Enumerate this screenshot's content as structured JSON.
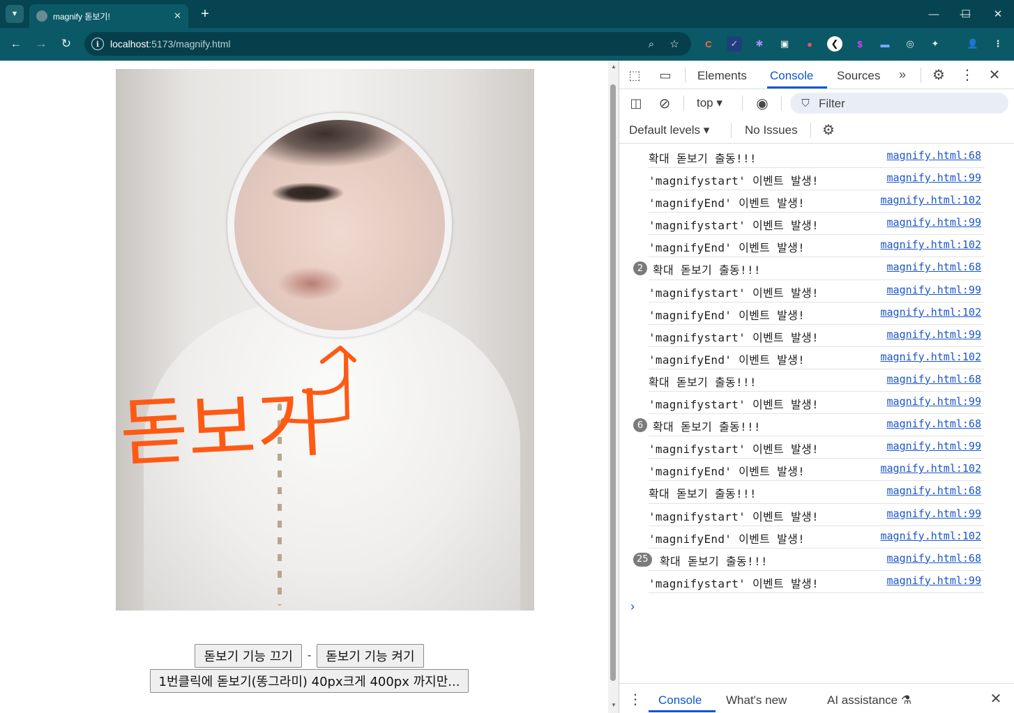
{
  "browser": {
    "tab_title": "magnify 돋보기!",
    "new_tab_symbol": "+",
    "url_host": "localhost",
    "url_rest": ":5173/magnify.html",
    "window_controls": [
      "—",
      "☐",
      "✕"
    ],
    "extension_icons": [
      "C",
      "✓",
      "✱",
      "▣",
      "●",
      "❮",
      "$",
      "▬",
      "◎",
      "✦",
      "👤",
      "⋮"
    ]
  },
  "page": {
    "annotation_text": "돋보기",
    "buttons": {
      "off": "돋보기 기능 끄기",
      "separator": "-",
      "on": "돋보기 기능 켜기",
      "circle": "1번클릭에 돋보기(똥그라미) 40px크게 400px 까지만..."
    }
  },
  "devtools": {
    "tabs": [
      "Elements",
      "Console",
      "Sources"
    ],
    "active_tab": "Console",
    "context": "top",
    "filter_placeholder": "Filter",
    "levels": "Default levels",
    "issues": "No Issues",
    "prompt_symbol": "›",
    "drawer_tabs": [
      "Console",
      "What's new",
      "AI assistance"
    ],
    "logs": [
      {
        "msg": "확대 돋보기 출동!!!",
        "src": "magnify.html:68",
        "badge": ""
      },
      {
        "msg": "'magnifystart' 이벤트 발생!",
        "src": "magnify.html:99",
        "badge": ""
      },
      {
        "msg": "'magnifyEnd' 이벤트 발생!",
        "src": "magnify.html:102",
        "badge": ""
      },
      {
        "msg": "'magnifystart' 이벤트 발생!",
        "src": "magnify.html:99",
        "badge": ""
      },
      {
        "msg": "'magnifyEnd' 이벤트 발생!",
        "src": "magnify.html:102",
        "badge": ""
      },
      {
        "msg": "확대 돋보기 출동!!!",
        "src": "magnify.html:68",
        "badge": "2"
      },
      {
        "msg": "'magnifystart' 이벤트 발생!",
        "src": "magnify.html:99",
        "badge": ""
      },
      {
        "msg": "'magnifyEnd' 이벤트 발생!",
        "src": "magnify.html:102",
        "badge": ""
      },
      {
        "msg": "'magnifystart' 이벤트 발생!",
        "src": "magnify.html:99",
        "badge": ""
      },
      {
        "msg": "'magnifyEnd' 이벤트 발생!",
        "src": "magnify.html:102",
        "badge": ""
      },
      {
        "msg": "확대 돋보기 출동!!!",
        "src": "magnify.html:68",
        "badge": ""
      },
      {
        "msg": "'magnifystart' 이벤트 발생!",
        "src": "magnify.html:99",
        "badge": ""
      },
      {
        "msg": "확대 돋보기 출동!!!",
        "src": "magnify.html:68",
        "badge": "6"
      },
      {
        "msg": "'magnifystart' 이벤트 발생!",
        "src": "magnify.html:99",
        "badge": ""
      },
      {
        "msg": "'magnifyEnd' 이벤트 발생!",
        "src": "magnify.html:102",
        "badge": ""
      },
      {
        "msg": "확대 돋보기 출동!!!",
        "src": "magnify.html:68",
        "badge": ""
      },
      {
        "msg": "'magnifystart' 이벤트 발생!",
        "src": "magnify.html:99",
        "badge": ""
      },
      {
        "msg": "'magnifyEnd' 이벤트 발생!",
        "src": "magnify.html:102",
        "badge": ""
      },
      {
        "msg": "확대 돋보기 출동!!!",
        "src": "magnify.html:68",
        "badge": "25"
      },
      {
        "msg": "'magnifystart' 이벤트 발생!",
        "src": "magnify.html:99",
        "badge": ""
      }
    ]
  },
  "colors": {
    "browser_frame": "#064451",
    "toolbar": "#0b5966",
    "devtools_accent": "#0b57d0",
    "annotation": "#ff5a14"
  }
}
